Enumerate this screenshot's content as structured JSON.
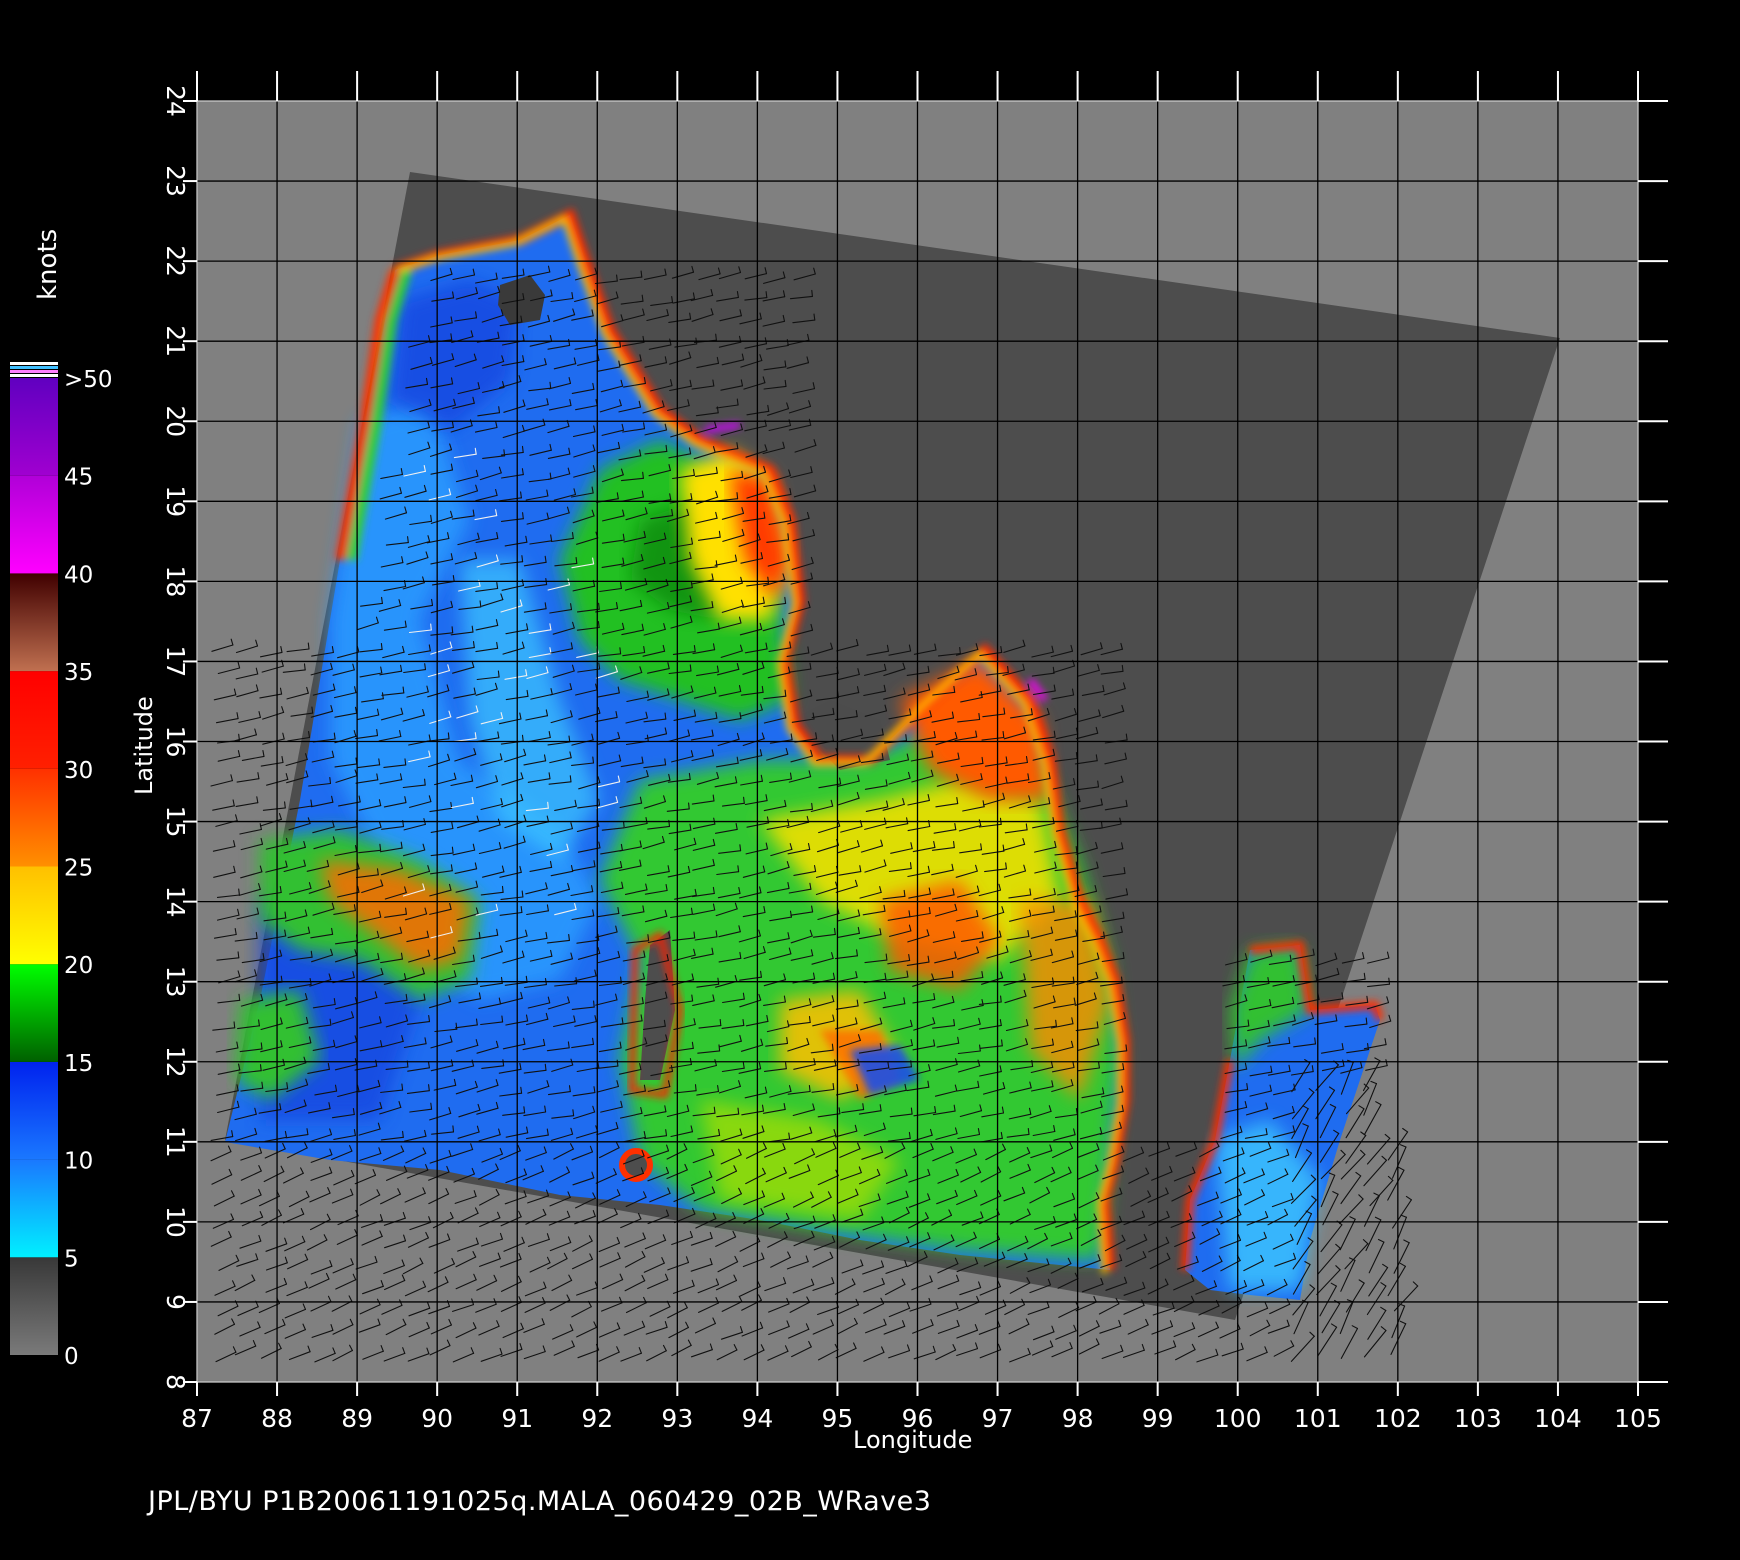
{
  "map": {
    "xlabel": "Longitude",
    "ylabel": "Latitude",
    "x_ticks": [
      "87",
      "88",
      "89",
      "90",
      "91",
      "92",
      "93",
      "94",
      "95",
      "96",
      "97",
      "98",
      "99",
      "100",
      "101",
      "102",
      "103",
      "104",
      "105"
    ],
    "y_ticks": [
      "8",
      "9",
      "10",
      "11",
      "12",
      "13",
      "14",
      "15",
      "16",
      "17",
      "18",
      "19",
      "20",
      "21",
      "22",
      "23",
      "24"
    ],
    "lon_range": [
      87,
      105
    ],
    "lat_range": [
      8,
      24
    ],
    "colors": {
      "background": "#000000",
      "land": "#808080",
      "swath": "#4d4d4d",
      "grid": "#000000"
    }
  },
  "colorbar": {
    "units": "knots",
    "labels": [
      ">50",
      "45",
      "40",
      "35",
      "30",
      "25",
      "20",
      "15",
      "10",
      "5",
      "0"
    ],
    "stops": [
      {
        "from": 0,
        "to": 5,
        "top": "#383838",
        "bottom": "#7a7a7a"
      },
      {
        "from": 5,
        "to": 10,
        "top": "#1a78ff",
        "bottom": "#00f0ff"
      },
      {
        "from": 10,
        "to": 15,
        "top": "#0022ee",
        "bottom": "#1a78ff"
      },
      {
        "from": 15,
        "to": 20,
        "top": "#00ff00",
        "bottom": "#006000"
      },
      {
        "from": 20,
        "to": 25,
        "top": "#ffc000",
        "bottom": "#ffff00"
      },
      {
        "from": 25,
        "to": 30,
        "top": "#ff3000",
        "bottom": "#ff9000"
      },
      {
        "from": 30,
        "to": 35,
        "top": "#ff0000",
        "bottom": "#ff2000"
      },
      {
        "from": 35,
        "to": 40,
        "top": "#400000",
        "bottom": "#c07050"
      },
      {
        "from": 40,
        "to": 45,
        "top": "#b000d8",
        "bottom": "#ff00ff"
      },
      {
        "from": 45,
        "to": 50,
        "top": "#6000c0",
        "bottom": "#a000d0"
      }
    ]
  },
  "footer": "JPL/BYU  P1B20061191025q.MALA_060429_02B_WRave3"
}
